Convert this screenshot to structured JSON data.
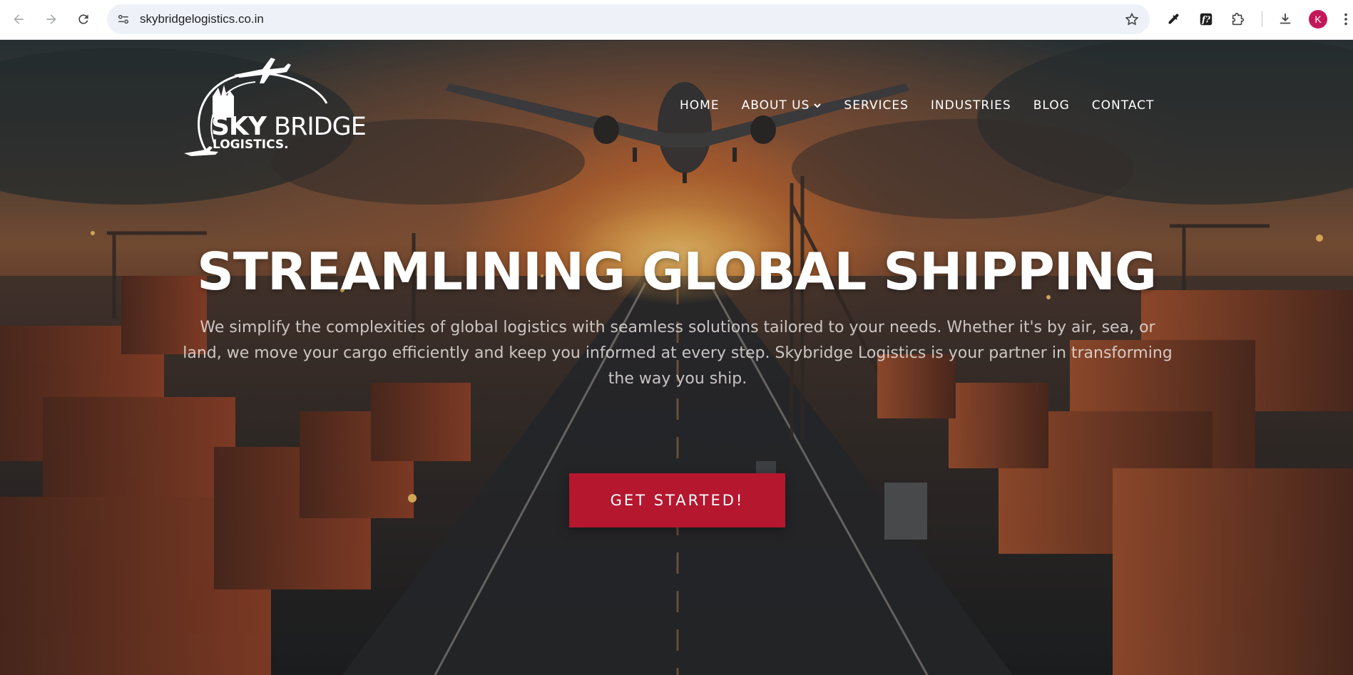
{
  "browser": {
    "url": "skybridgelogistics.co.in",
    "profile_initial": "K",
    "icons": {
      "back": "back-arrow-icon",
      "forward": "forward-arrow-icon",
      "reload": "reload-icon",
      "site_info": "site-info-icon",
      "bookmark": "star-icon",
      "eyedropper": "eyedropper-icon",
      "font_ext": "font-extension-icon",
      "extensions": "puzzle-icon",
      "downloads": "download-icon",
      "menu": "kebab-menu-icon"
    },
    "accent": "#c2185b"
  },
  "site": {
    "logo": {
      "word_sky": "SKY",
      "word_bridge": "BRIDGE",
      "word_logistics": "LOGISTICS."
    },
    "nav": [
      {
        "label": "HOME"
      },
      {
        "label": "ABOUT US",
        "has_dropdown": true
      },
      {
        "label": "SERVICES"
      },
      {
        "label": "INDUSTRIES"
      },
      {
        "label": "BLOG"
      },
      {
        "label": "CONTACT"
      }
    ],
    "hero": {
      "title": "STREAMLINING GLOBAL SHIPPING",
      "subtitle": "We simplify the complexities of global logistics with seamless solutions tailored to your needs. Whether it's by air, sea, or land, we move your cargo efficiently and keep you informed at every step. Skybridge Logistics is your partner in transforming the way you ship.",
      "cta_label": "GET STARTED!"
    },
    "colors": {
      "cta_background": "#b5172f",
      "text": "#ffffff"
    }
  }
}
